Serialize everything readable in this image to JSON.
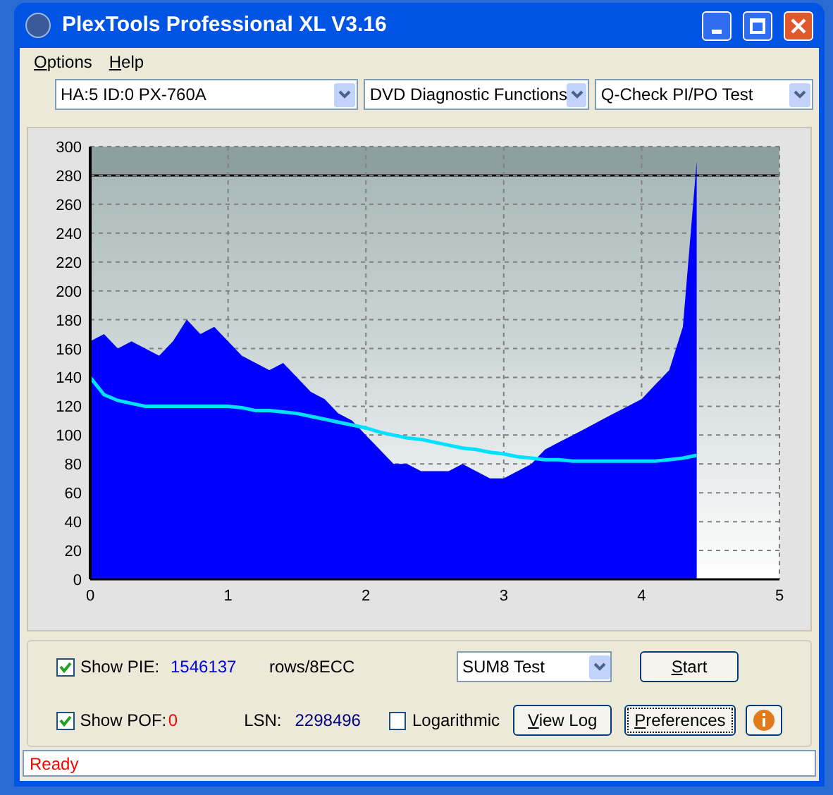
{
  "window": {
    "title": "PlexTools Professional XL V3.16"
  },
  "menu": [
    {
      "label": "Options"
    },
    {
      "label": "Help"
    }
  ],
  "selectors": [
    {
      "value": "HA:5 ID:0  PX-760A"
    },
    {
      "value": "DVD Diagnostic Functions"
    },
    {
      "value": "Q-Check PI/PO Test"
    }
  ],
  "chart": {
    "chart_data": {
      "type": "area",
      "xlim": [
        0,
        5
      ],
      "ylim": [
        0,
        300
      ],
      "xticks": [
        0,
        1,
        2,
        3,
        4,
        5
      ],
      "yticks": [
        0,
        20,
        40,
        60,
        80,
        100,
        120,
        140,
        160,
        180,
        200,
        220,
        240,
        260,
        280,
        300
      ],
      "x": [
        0,
        0.1,
        0.2,
        0.3,
        0.4,
        0.5,
        0.6,
        0.7,
        0.8,
        0.9,
        1,
        1.1,
        1.2,
        1.3,
        1.4,
        1.5,
        1.6,
        1.7,
        1.8,
        1.9,
        2,
        2.1,
        2.2,
        2.3,
        2.4,
        2.5,
        2.6,
        2.7,
        2.8,
        2.9,
        3,
        3.1,
        3.2,
        3.3,
        3.4,
        3.5,
        3.6,
        3.7,
        3.8,
        3.9,
        4,
        4.1,
        4.2,
        4.3,
        4.4
      ],
      "series": [
        {
          "color": "#0000ff",
          "values": [
            165,
            170,
            160,
            165,
            160,
            155,
            165,
            180,
            170,
            175,
            165,
            155,
            150,
            145,
            150,
            140,
            130,
            125,
            115,
            110,
            100,
            90,
            80,
            80,
            75,
            75,
            75,
            80,
            75,
            70,
            70,
            75,
            80,
            90,
            95,
            100,
            105,
            110,
            115,
            120,
            125,
            135,
            145,
            175,
            290
          ]
        },
        {
          "type": "line",
          "color": "#00e0ff",
          "values": [
            140,
            128,
            124,
            122,
            120,
            120,
            120,
            120,
            120,
            120,
            120,
            119,
            117,
            117,
            116,
            115,
            113,
            111,
            109,
            107,
            105,
            102,
            100,
            98,
            97,
            95,
            93,
            91,
            90,
            88,
            87,
            85,
            84,
            83,
            83,
            82,
            82,
            82,
            82,
            82,
            82,
            82,
            83,
            84,
            86
          ]
        }
      ],
      "grid": true,
      "bands": [
        {
          "axis": "y",
          "from": 280,
          "to": 300
        }
      ],
      "ref_lines": [
        {
          "axis": "y",
          "value": 280
        }
      ]
    }
  },
  "controls": {
    "show_pie": {
      "label": "Show PIE:",
      "checked": true,
      "value": "1546137",
      "unit": "rows/8ECC"
    },
    "show_pof": {
      "label": "Show POF:",
      "checked": true,
      "value": "0"
    },
    "lsn": {
      "label": "LSN:",
      "value": "2298496"
    },
    "logarithmic": {
      "label": "Logarithmic",
      "checked": false
    },
    "test_mode": {
      "value": "SUM8 Test"
    },
    "buttons": [
      {
        "label": "Start"
      },
      {
        "label": "View Log"
      },
      {
        "label": "Preferences"
      }
    ]
  },
  "status_bar": {
    "text": "Ready"
  }
}
